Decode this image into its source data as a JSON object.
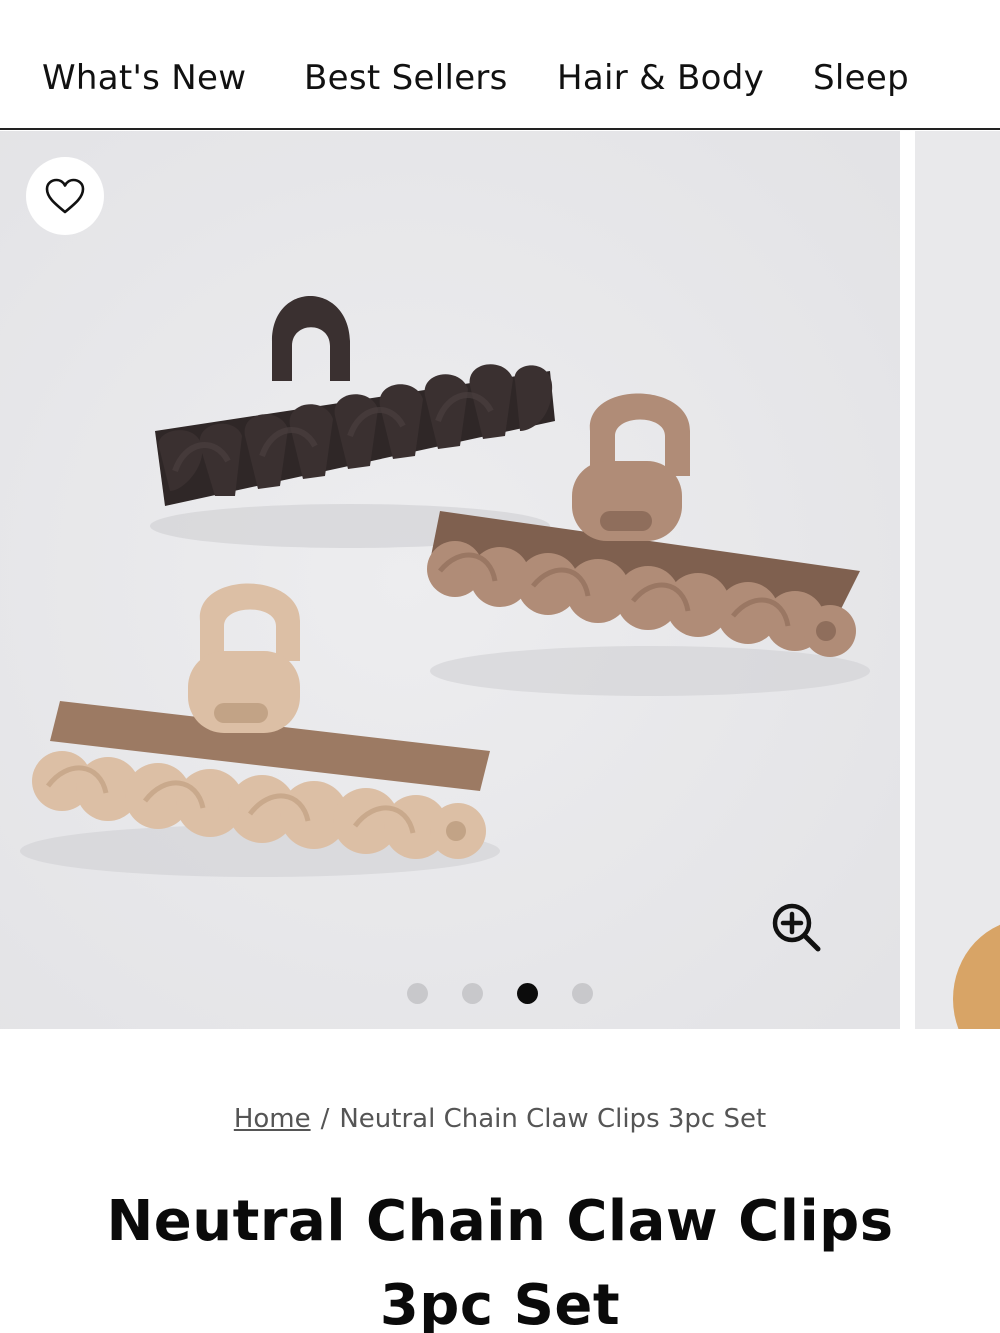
{
  "nav": {
    "items": [
      {
        "label": "What's New"
      },
      {
        "label": "Best Sellers"
      },
      {
        "label": "Hair & Body"
      },
      {
        "label": "Sleep"
      }
    ]
  },
  "gallery": {
    "slide_count": 4,
    "active_slide": 3,
    "icons": {
      "favorite": "heart-outline-icon",
      "zoom": "zoom-in-icon"
    },
    "clip_colors": {
      "dark": "#3a3030",
      "mocha": "#b08c77",
      "sand": "#dcbfa5"
    }
  },
  "breadcrumb": {
    "home": "Home",
    "separator": "/",
    "current": "Neutral Chain Claw Clips 3pc Set"
  },
  "product": {
    "title": "Neutral Chain Claw Clips 3pc Set"
  }
}
